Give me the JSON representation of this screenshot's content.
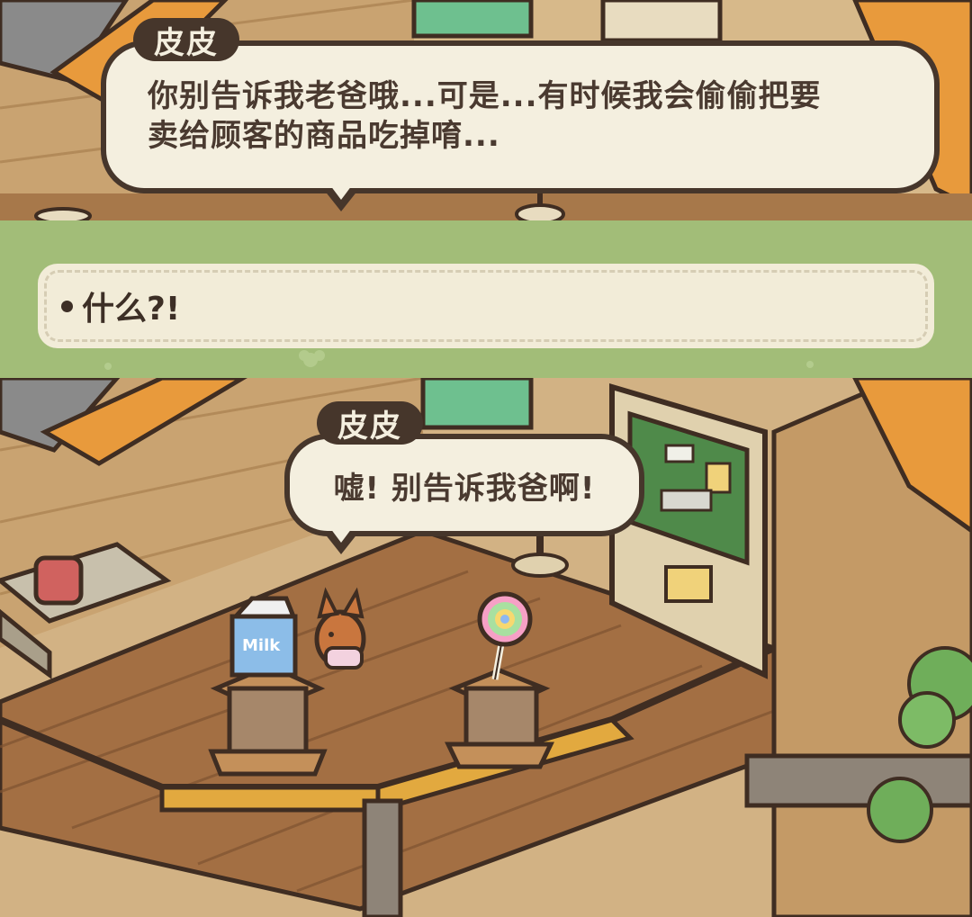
{
  "top_dialogue": {
    "speaker": "皮皮",
    "lines": [
      "你别告诉我老爸哦...可是...有时候我会偷偷把要",
      "卖给顾客的商品吃掉唷..."
    ]
  },
  "choice": {
    "label": "什么?!"
  },
  "bottom_dialogue": {
    "speaker": "皮皮",
    "text": "嘘! 别告诉我爸啊!"
  },
  "scene_items": {
    "milk_carton_text": "Milk"
  }
}
